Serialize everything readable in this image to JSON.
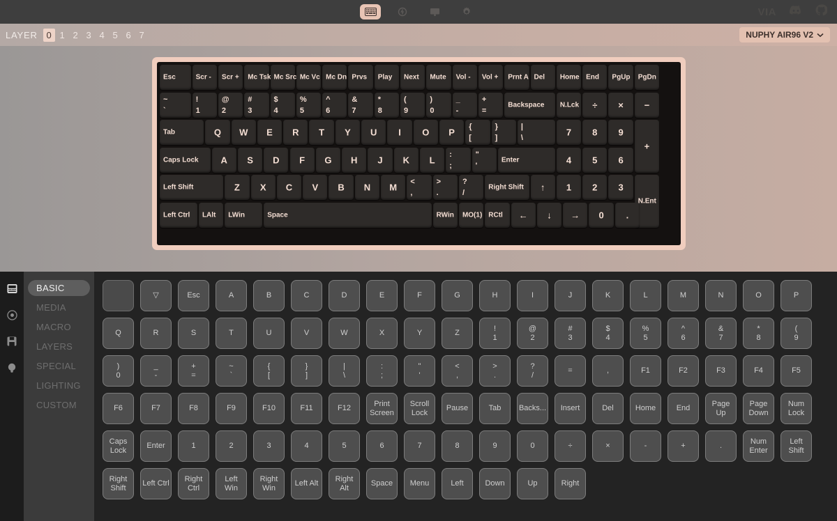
{
  "topbar": {
    "tools": [
      {
        "name": "keyboard-icon",
        "active": true
      },
      {
        "name": "lightning-icon",
        "active": false
      },
      {
        "name": "display-icon",
        "active": false
      },
      {
        "name": "gear-icon",
        "active": false
      }
    ],
    "via_label": "VIA",
    "right_icons": [
      "discord-icon",
      "github-icon"
    ]
  },
  "layerbar": {
    "label": "LAYER",
    "layers": [
      "0",
      "1",
      "2",
      "3",
      "4",
      "5",
      "6",
      "7"
    ],
    "active_layer": "0",
    "keyboard_select": "NUPHY AIR96 V2",
    "chevron": "⌄"
  },
  "keyboard": {
    "rows": [
      [
        {
          "l": "Esc",
          "w": 1.25
        },
        {
          "l": "Scr -",
          "w": 1
        },
        {
          "l": "Scr +",
          "w": 1
        },
        {
          "l": "Mc Tsk",
          "w": 1
        },
        {
          "l": "Mc Src",
          "w": 1
        },
        {
          "l": "Mc Vc",
          "w": 1
        },
        {
          "l": "Mc Dn",
          "w": 1
        },
        {
          "l": "Prvs",
          "w": 1
        },
        {
          "l": "Play",
          "w": 1
        },
        {
          "l": "Next",
          "w": 1
        },
        {
          "l": "Mute",
          "w": 1
        },
        {
          "l": "Vol -",
          "w": 1
        },
        {
          "l": "Vol +",
          "w": 1
        },
        {
          "l": "Prnt A",
          "w": 1
        },
        {
          "l": "Del",
          "w": 1
        },
        {
          "l": "Home",
          "w": 1
        },
        {
          "l": "End",
          "w": 1
        },
        {
          "l": "PgUp",
          "w": 1
        },
        {
          "l": "PgDn",
          "w": 1
        }
      ],
      [
        {
          "t": "~",
          "b": "`",
          "w": 1.25
        },
        {
          "t": "!",
          "b": "1",
          "w": 1
        },
        {
          "t": "@",
          "b": "2",
          "w": 1
        },
        {
          "t": "#",
          "b": "3",
          "w": 1
        },
        {
          "t": "$",
          "b": "4",
          "w": 1
        },
        {
          "t": "%",
          "b": "5",
          "w": 1
        },
        {
          "t": "^",
          "b": "6",
          "w": 1
        },
        {
          "t": "&",
          "b": "7",
          "w": 1
        },
        {
          "t": "*",
          "b": "8",
          "w": 1
        },
        {
          "t": "(",
          "b": "9",
          "w": 1
        },
        {
          "t": ")",
          "b": "0",
          "w": 1
        },
        {
          "t": "_",
          "b": "-",
          "w": 1
        },
        {
          "t": "+",
          "b": "=",
          "w": 1
        },
        {
          "l": "Backspace",
          "w": 2
        },
        {
          "l": "N.Lck",
          "w": 1
        },
        {
          "l": "÷",
          "w": 1,
          "c": true
        },
        {
          "l": "×",
          "w": 1,
          "c": true
        },
        {
          "l": "−",
          "w": 1,
          "c": true
        }
      ],
      [
        {
          "l": "Tab",
          "w": 1.75
        },
        {
          "l": "Q",
          "w": 1,
          "c": true
        },
        {
          "l": "W",
          "w": 1,
          "c": true
        },
        {
          "l": "E",
          "w": 1,
          "c": true
        },
        {
          "l": "R",
          "w": 1,
          "c": true
        },
        {
          "l": "T",
          "w": 1,
          "c": true
        },
        {
          "l": "Y",
          "w": 1,
          "c": true
        },
        {
          "l": "U",
          "w": 1,
          "c": true
        },
        {
          "l": "I",
          "w": 1,
          "c": true
        },
        {
          "l": "O",
          "w": 1,
          "c": true
        },
        {
          "l": "P",
          "w": 1,
          "c": true
        },
        {
          "t": "{",
          "b": "[",
          "w": 1
        },
        {
          "t": "}",
          "b": "]",
          "w": 1
        },
        {
          "t": "|",
          "b": "\\",
          "w": 1.5
        },
        {
          "l": "7",
          "w": 1,
          "c": true
        },
        {
          "l": "8",
          "w": 1,
          "c": true
        },
        {
          "l": "9",
          "w": 1,
          "c": true
        },
        {
          "l": "+",
          "w": 1,
          "c": true,
          "h": 2
        }
      ],
      [
        {
          "l": "Caps Lock",
          "w": 2
        },
        {
          "l": "A",
          "w": 1,
          "c": true
        },
        {
          "l": "S",
          "w": 1,
          "c": true
        },
        {
          "l": "D",
          "w": 1,
          "c": true
        },
        {
          "l": "F",
          "w": 1,
          "c": true
        },
        {
          "l": "G",
          "w": 1,
          "c": true
        },
        {
          "l": "H",
          "w": 1,
          "c": true
        },
        {
          "l": "J",
          "w": 1,
          "c": true
        },
        {
          "l": "K",
          "w": 1,
          "c": true
        },
        {
          "l": "L",
          "w": 1,
          "c": true
        },
        {
          "t": ":",
          "b": ";",
          "w": 1
        },
        {
          "t": "\"",
          "b": "'",
          "w": 1
        },
        {
          "l": "Enter",
          "w": 2.25
        },
        {
          "l": "4",
          "w": 1,
          "c": true
        },
        {
          "l": "5",
          "w": 1,
          "c": true
        },
        {
          "l": "6",
          "w": 1,
          "c": true
        }
      ],
      [
        {
          "l": "Left Shift",
          "w": 2.5
        },
        {
          "l": "Z",
          "w": 1,
          "c": true
        },
        {
          "l": "X",
          "w": 1,
          "c": true
        },
        {
          "l": "C",
          "w": 1,
          "c": true
        },
        {
          "l": "V",
          "w": 1,
          "c": true
        },
        {
          "l": "B",
          "w": 1,
          "c": true
        },
        {
          "l": "N",
          "w": 1,
          "c": true
        },
        {
          "l": "M",
          "w": 1,
          "c": true
        },
        {
          "t": "<",
          "b": ",",
          "w": 1
        },
        {
          "t": ">",
          "b": ".",
          "w": 1
        },
        {
          "t": "?",
          "b": "/",
          "w": 1
        },
        {
          "l": "Right Shift",
          "w": 1.75
        },
        {
          "l": "↑",
          "w": 1,
          "c": true
        },
        {
          "l": "1",
          "w": 1,
          "c": true
        },
        {
          "l": "2",
          "w": 1,
          "c": true
        },
        {
          "l": "3",
          "w": 1,
          "c": true
        },
        {
          "l": "N.Ent",
          "w": 1,
          "h": 2
        }
      ],
      [
        {
          "l": "Left Ctrl",
          "w": 1.5
        },
        {
          "l": "LAlt",
          "w": 1
        },
        {
          "l": "LWin",
          "w": 1.5
        },
        {
          "l": "Space",
          "w": 6.5
        },
        {
          "l": "RWin",
          "w": 1
        },
        {
          "l": "MO(1)",
          "w": 1
        },
        {
          "l": "RCtl",
          "w": 1
        },
        {
          "l": "←",
          "w": 1,
          "c": true
        },
        {
          "l": "↓",
          "w": 1,
          "c": true
        },
        {
          "l": "→",
          "w": 1,
          "c": true
        },
        {
          "l": "0",
          "w": 1,
          "c": true
        },
        {
          "l": ".",
          "w": 1,
          "c": true
        }
      ]
    ]
  },
  "rail": {
    "icons": [
      {
        "name": "keyboard-rail-icon",
        "active": true
      },
      {
        "name": "record-rail-icon",
        "active": false
      },
      {
        "name": "save-rail-icon",
        "active": false
      },
      {
        "name": "bulb-rail-icon",
        "active": false
      }
    ]
  },
  "tabs": {
    "items": [
      "BASIC",
      "MEDIA",
      "MACRO",
      "LAYERS",
      "SPECIAL",
      "LIGHTING",
      "CUSTOM"
    ],
    "active": "BASIC"
  },
  "picker": {
    "rows": [
      [
        {
          "t": ""
        },
        {
          "t": "▽"
        },
        {
          "t": "Esc"
        },
        {
          "t": "A"
        },
        {
          "t": "B"
        },
        {
          "t": "C"
        },
        {
          "t": "D"
        },
        {
          "t": "E"
        },
        {
          "t": "F"
        },
        {
          "t": "G"
        },
        {
          "t": "H"
        },
        {
          "t": "I"
        },
        {
          "t": "J"
        },
        {
          "t": "K"
        },
        {
          "t": "L"
        },
        {
          "t": "M"
        },
        {
          "t": "N"
        },
        {
          "t": "O"
        },
        {
          "t": "P"
        }
      ],
      [
        {
          "t": "Q"
        },
        {
          "t": "R"
        },
        {
          "t": "S"
        },
        {
          "t": "T"
        },
        {
          "t": "U"
        },
        {
          "t": "V"
        },
        {
          "t": "W"
        },
        {
          "t": "X"
        },
        {
          "t": "Y"
        },
        {
          "t": "Z"
        },
        {
          "s1": "!",
          "s2": "1"
        },
        {
          "s1": "@",
          "s2": "2"
        },
        {
          "s1": "#",
          "s2": "3"
        },
        {
          "s1": "$",
          "s2": "4"
        },
        {
          "s1": "%",
          "s2": "5"
        },
        {
          "s1": "^",
          "s2": "6"
        },
        {
          "s1": "&",
          "s2": "7"
        },
        {
          "s1": "*",
          "s2": "8"
        },
        {
          "s1": "(",
          "s2": "9"
        }
      ],
      [
        {
          "s1": ")",
          "s2": "0"
        },
        {
          "s1": "_",
          "s2": "-"
        },
        {
          "s1": "+",
          "s2": "="
        },
        {
          "s1": "~",
          "s2": "`"
        },
        {
          "s1": "{",
          "s2": "["
        },
        {
          "s1": "}",
          "s2": "]"
        },
        {
          "s1": "|",
          "s2": "\\"
        },
        {
          "s1": ":",
          "s2": ";"
        },
        {
          "s1": "\"",
          "s2": "'"
        },
        {
          "s1": "<",
          "s2": ","
        },
        {
          "s1": ">",
          "s2": "."
        },
        {
          "s1": "?",
          "s2": "/"
        },
        {
          "t": "="
        },
        {
          "t": ","
        },
        {
          "t": "F1"
        },
        {
          "t": "F2"
        },
        {
          "t": "F3"
        },
        {
          "t": "F4"
        },
        {
          "t": "F5"
        }
      ],
      [
        {
          "t": "F6"
        },
        {
          "t": "F7"
        },
        {
          "t": "F8"
        },
        {
          "t": "F9"
        },
        {
          "t": "F10"
        },
        {
          "t": "F11"
        },
        {
          "t": "F12"
        },
        {
          "s1": "Print",
          "s2": "Screen"
        },
        {
          "s1": "Scroll",
          "s2": "Lock"
        },
        {
          "t": "Pause"
        },
        {
          "t": "Tab"
        },
        {
          "t": "Backs..."
        },
        {
          "t": "Insert"
        },
        {
          "t": "Del"
        },
        {
          "t": "Home"
        },
        {
          "t": "End"
        },
        {
          "s1": "Page",
          "s2": "Up"
        },
        {
          "s1": "Page",
          "s2": "Down"
        },
        {
          "s1": "Num",
          "s2": "Lock"
        }
      ],
      [
        {
          "s1": "Caps",
          "s2": "Lock"
        },
        {
          "t": "Enter"
        },
        {
          "t": "1"
        },
        {
          "t": "2"
        },
        {
          "t": "3"
        },
        {
          "t": "4"
        },
        {
          "t": "5"
        },
        {
          "t": "6"
        },
        {
          "t": "7"
        },
        {
          "t": "8"
        },
        {
          "t": "9"
        },
        {
          "t": "0"
        },
        {
          "t": "÷"
        },
        {
          "t": "×"
        },
        {
          "t": "-"
        },
        {
          "t": "+"
        },
        {
          "t": "."
        },
        {
          "s1": "Num",
          "s2": "Enter"
        },
        {
          "s1": "Left",
          "s2": "Shift"
        }
      ],
      [
        {
          "s1": "Right",
          "s2": "Shift"
        },
        {
          "t": "Left Ctrl"
        },
        {
          "s1": "Right",
          "s2": "Ctrl"
        },
        {
          "s1": "Left",
          "s2": "Win"
        },
        {
          "s1": "Right",
          "s2": "Win"
        },
        {
          "t": "Left Alt"
        },
        {
          "s1": "Right",
          "s2": "Alt"
        },
        {
          "t": "Space"
        },
        {
          "t": "Menu"
        },
        {
          "t": "Left"
        },
        {
          "t": "Down"
        },
        {
          "t": "Up"
        },
        {
          "t": "Right"
        }
      ]
    ]
  },
  "colors": {
    "accent": "#e8c4b4",
    "case": "#f0cdbe",
    "key_dark": "#2e2b29",
    "panel": "#232323"
  }
}
